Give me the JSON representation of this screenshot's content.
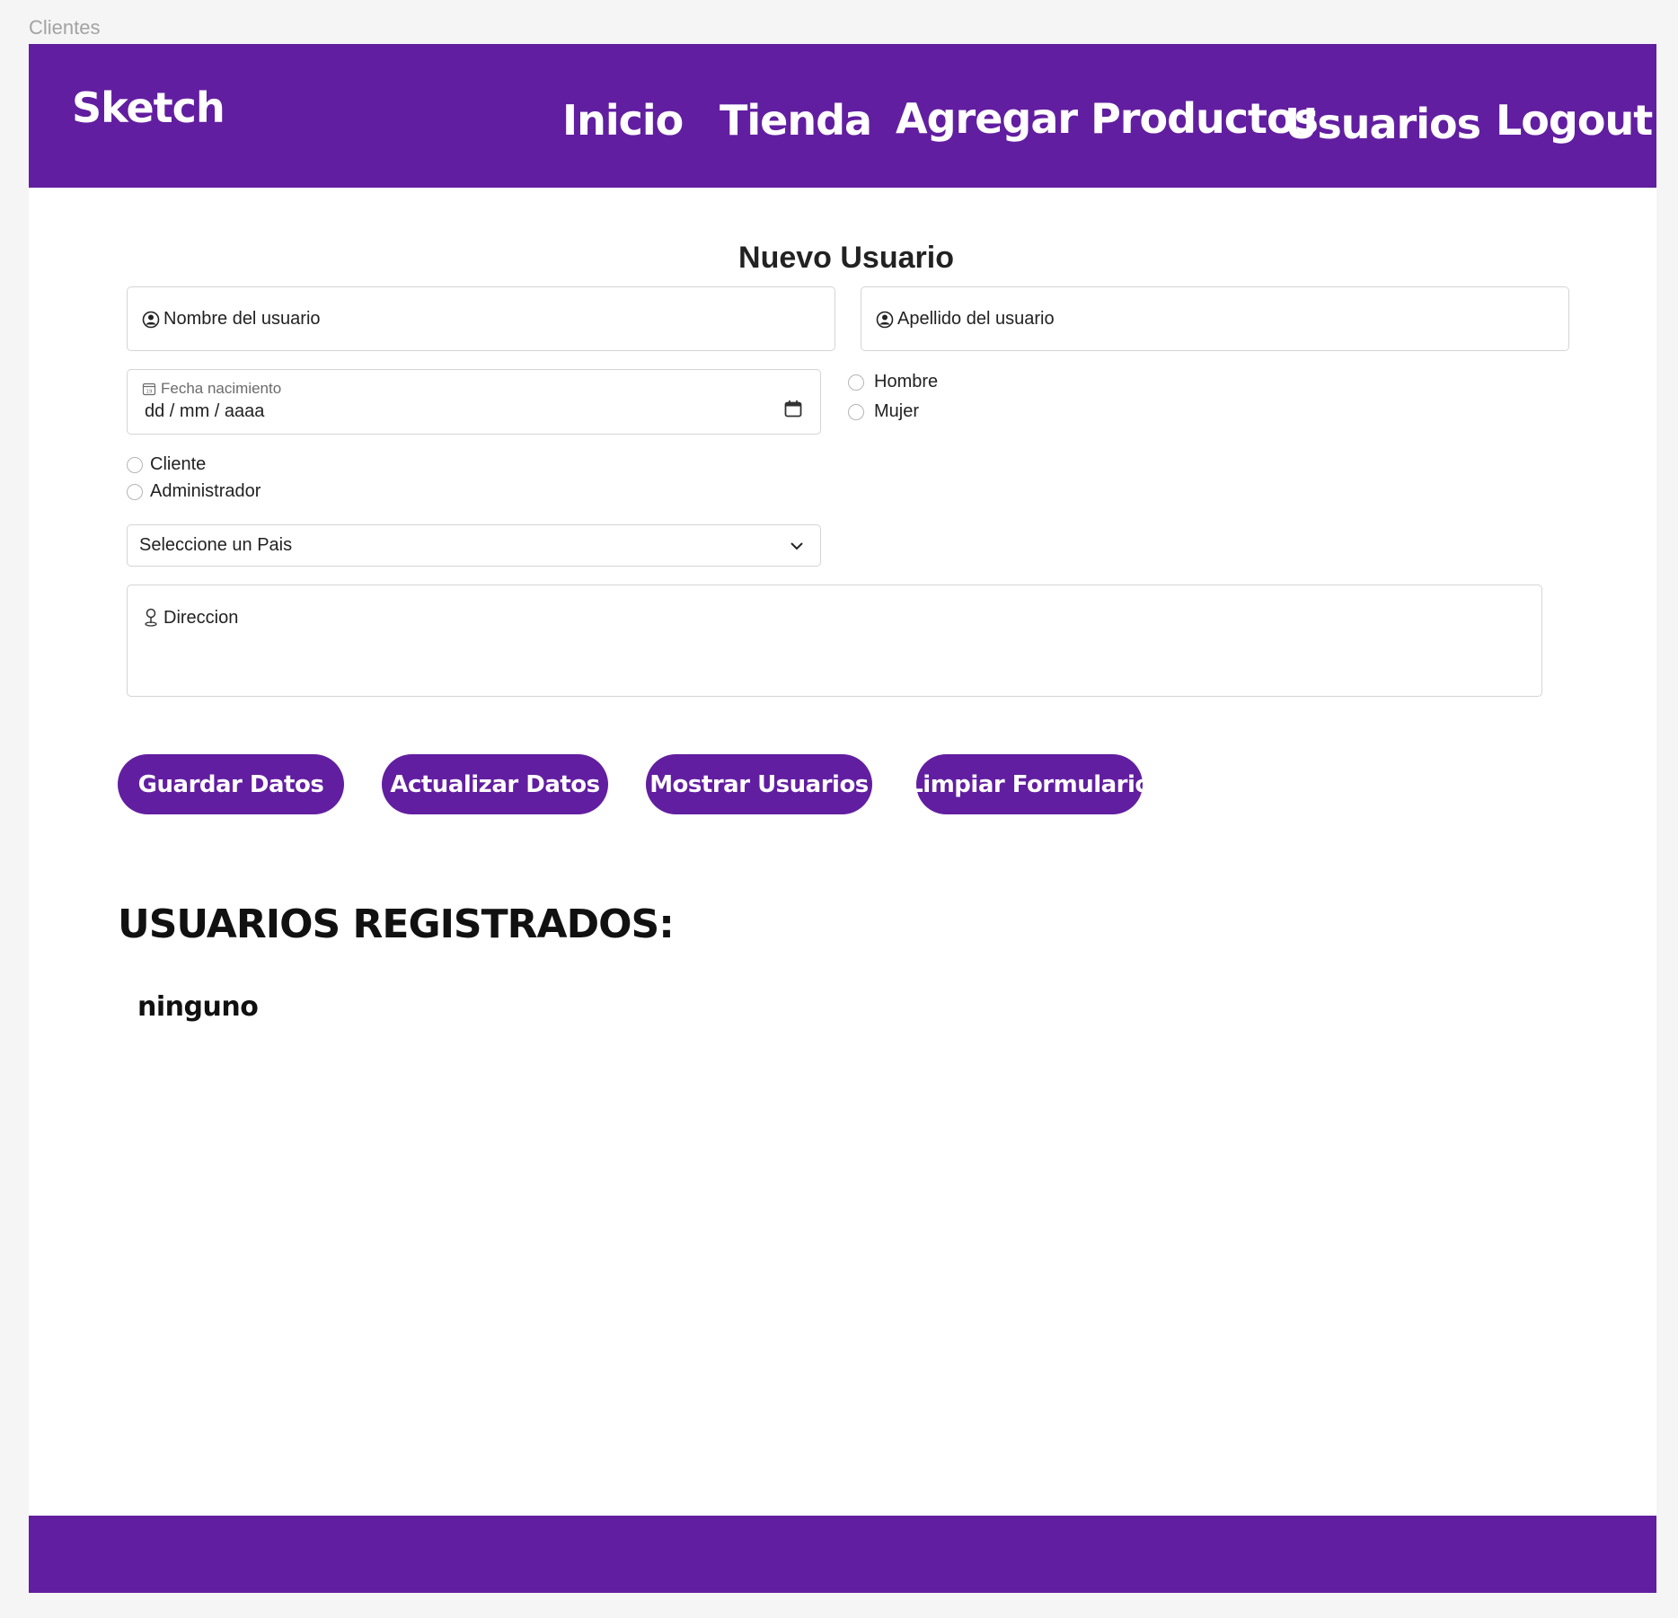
{
  "frame": {
    "label": "Clientes"
  },
  "navbar": {
    "brand": "Sketch",
    "links": [
      "Inicio",
      "Tienda",
      "Agregar Productos",
      "Usuarios",
      "Logout"
    ]
  },
  "form": {
    "title": "Nuevo Usuario",
    "nombre_placeholder": "Nombre del usuario",
    "apellido_placeholder": "Apellido del usuario",
    "fecha_label": "Fecha nacimiento",
    "fecha_value": "dd / mm / aaaa",
    "genero_options": [
      "Hombre",
      "Mujer"
    ],
    "rol_options": [
      "Cliente",
      "Administrador"
    ],
    "pais_selected": "Seleccione un Pais",
    "direccion_placeholder": "Direccion",
    "icons": {
      "user": "user-circle-icon",
      "calendar_small": "calendar-small-icon",
      "calendar": "calendar-icon",
      "chevron": "chevron-down-icon",
      "location": "location-pin-icon"
    }
  },
  "buttons": {
    "guardar": "Guardar Datos",
    "actualizar": "Actualizar Datos",
    "mostrar": "Mostrar Usuarios",
    "limpiar": "Limpiar Formulario"
  },
  "usuarios": {
    "heading": "USUARIOS REGISTRADOS:",
    "empty": "ninguno"
  },
  "colors": {
    "primary": "#621ea0",
    "background": "#f5f5f5",
    "surface": "#ffffff"
  }
}
